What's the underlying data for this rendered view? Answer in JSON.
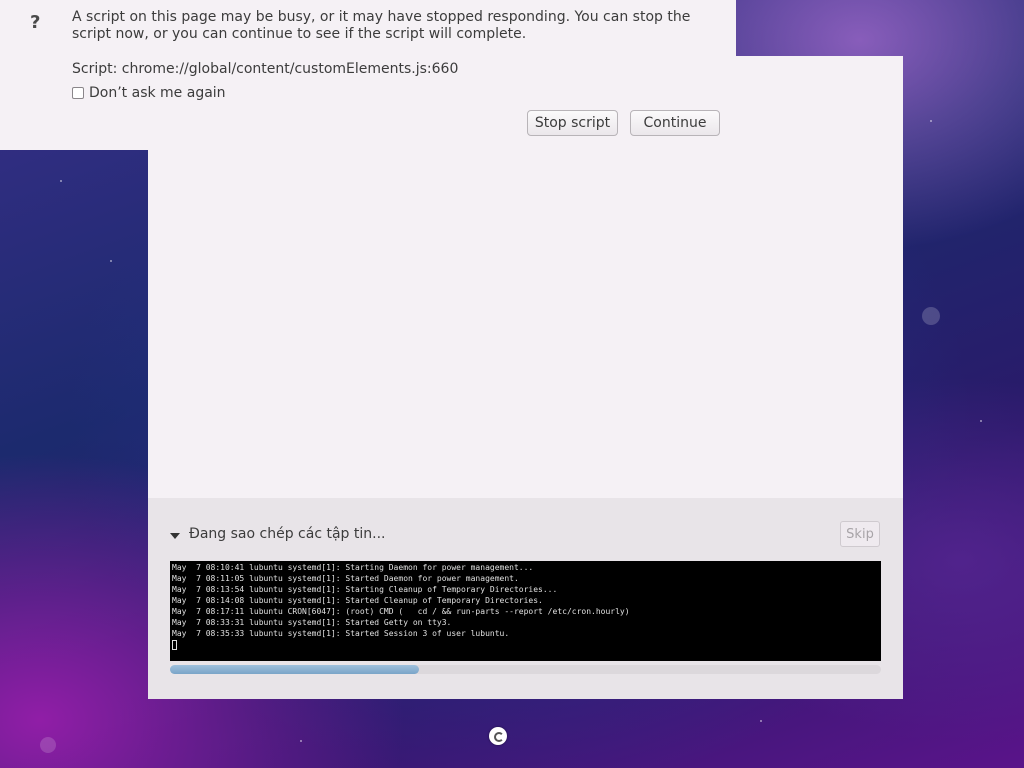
{
  "dialog": {
    "icon": "question-icon",
    "icon_glyph": "?",
    "message": "A script on this page may be busy, or it may have stopped responding. You can stop the script now, or you can continue to see if the script will complete.",
    "script_label": "Script: chrome://global/content/customElements.js:660",
    "dont_ask_label": "Don’t ask me again",
    "stop_label": "Stop script",
    "continue_label": "Continue"
  },
  "installer": {
    "status_text": "Đang sao chép các tập tin...",
    "skip_label": "Skip",
    "log_lines": [
      "May  7 08:10:41 lubuntu systemd[1]: Starting Daemon for power management...",
      "May  7 08:11:05 lubuntu systemd[1]: Started Daemon for power management.",
      "May  7 08:13:54 lubuntu systemd[1]: Starting Cleanup of Temporary Directories...",
      "May  7 08:14:08 lubuntu systemd[1]: Started Cleanup of Temporary Directories.",
      "May  7 08:17:11 lubuntu CRON[6047]: (root) CMD (   cd / && run-parts --report /etc/cron.hourly)",
      "May  7 08:33:31 lubuntu systemd[1]: Started Getty on tty3.",
      "May  7 08:35:33 lubuntu systemd[1]: Started Session 3 of user lubuntu."
    ],
    "progress_fraction": 0.35
  },
  "colors": {
    "progress_fill": "#7aa4c8",
    "window_bg": "#f5f1f5",
    "terminal_bg": "#000000"
  }
}
